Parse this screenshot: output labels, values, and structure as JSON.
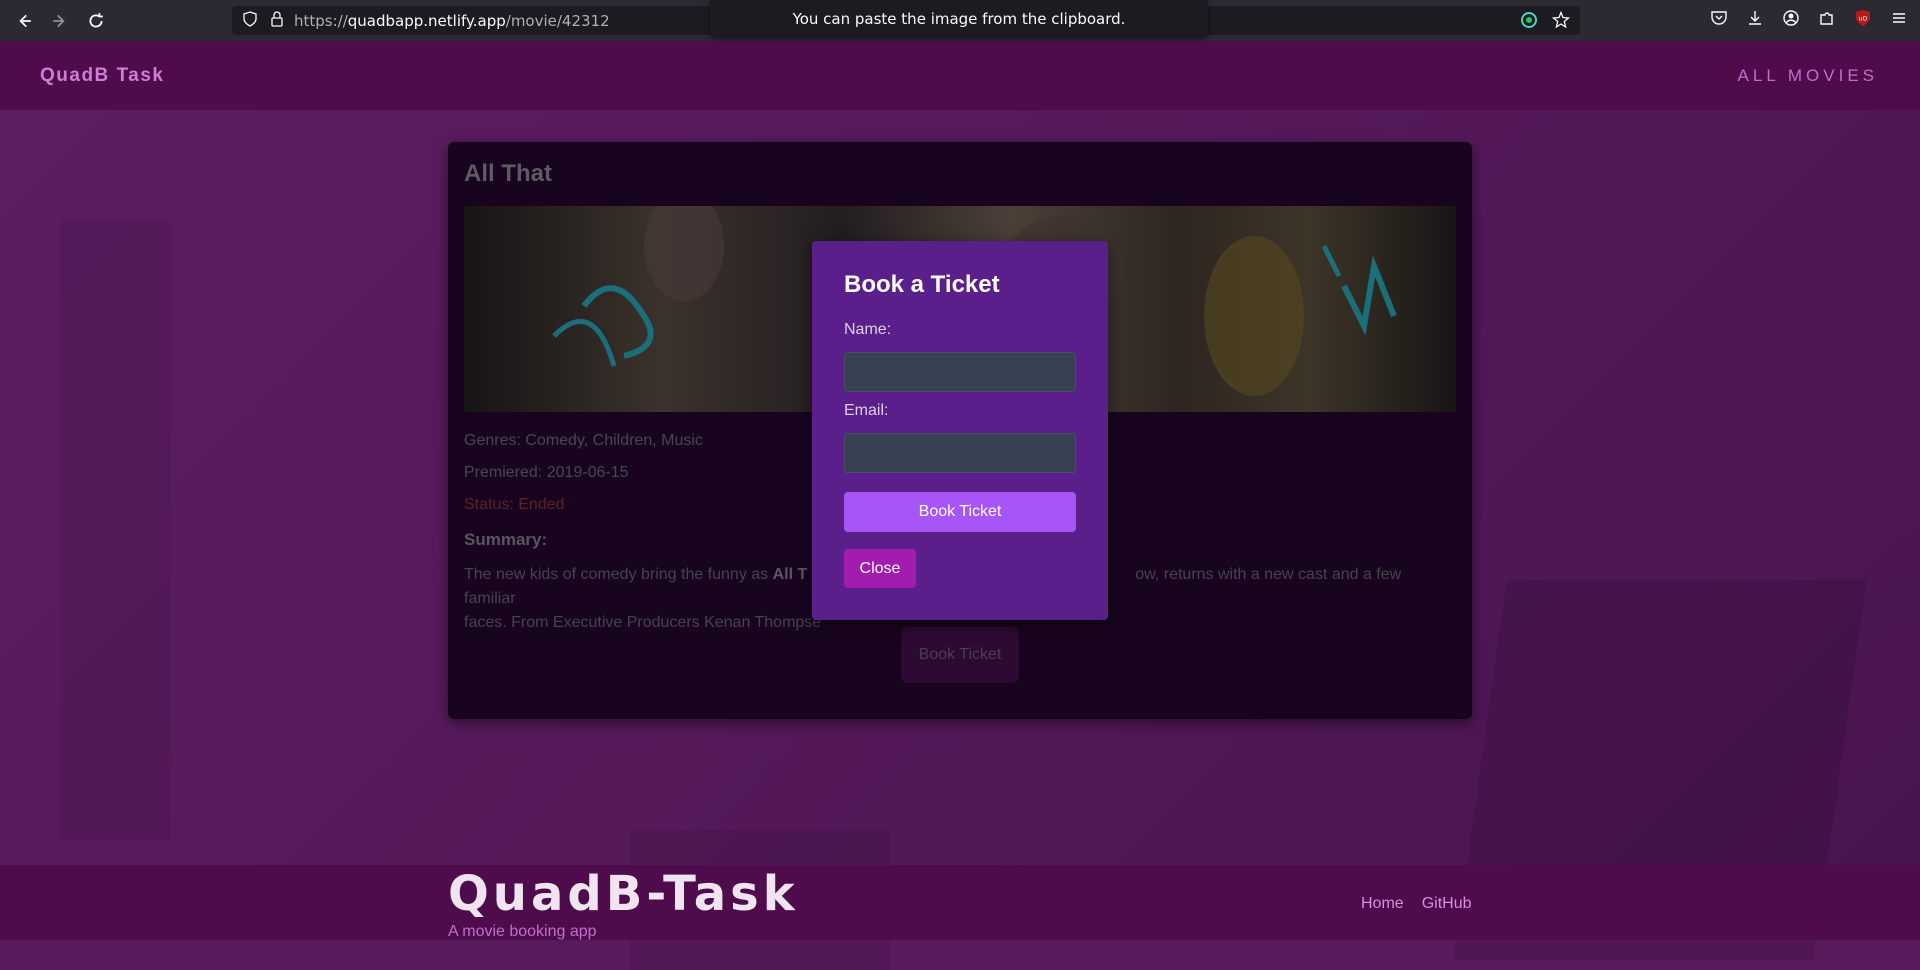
{
  "browser": {
    "url_scheme": "https://",
    "url_host": "quadbapp.netlify.app",
    "url_path": "/movie/42312",
    "clipboard_notice": "You can paste the image from the clipboard."
  },
  "header": {
    "brand": "QuadB Task",
    "all_movies": "ALL MOVIES"
  },
  "movie": {
    "title": "All That",
    "genres": "Genres: Comedy, Children, Music",
    "premiered": "Premiered: 2019-06-15",
    "status": "Status: Ended",
    "summary_heading": "Summary:",
    "summary_before": "The new kids of comedy bring the funny as ",
    "summary_bold": "All T",
    "summary_middle": "",
    "summary_after_line1": "ow, returns with a new cast and a few familiar",
    "summary_line2": "faces. From Executive Producers Kenan Thompse",
    "book_button": "Book Ticket"
  },
  "modal": {
    "title": "Book a Ticket",
    "name_label": "Name:",
    "email_label": "Email:",
    "name_value": "",
    "email_value": "",
    "book_button": "Book Ticket",
    "close_button": "Close"
  },
  "footer": {
    "title": "QuadB-Task",
    "subtitle": "A movie booking app",
    "links": [
      "Home",
      "GitHub"
    ]
  },
  "colors": {
    "accent": "#a855f7",
    "close": "#a21caf",
    "modal_bg": "#5a1f8a",
    "header_bg": "#4e0c4d"
  }
}
